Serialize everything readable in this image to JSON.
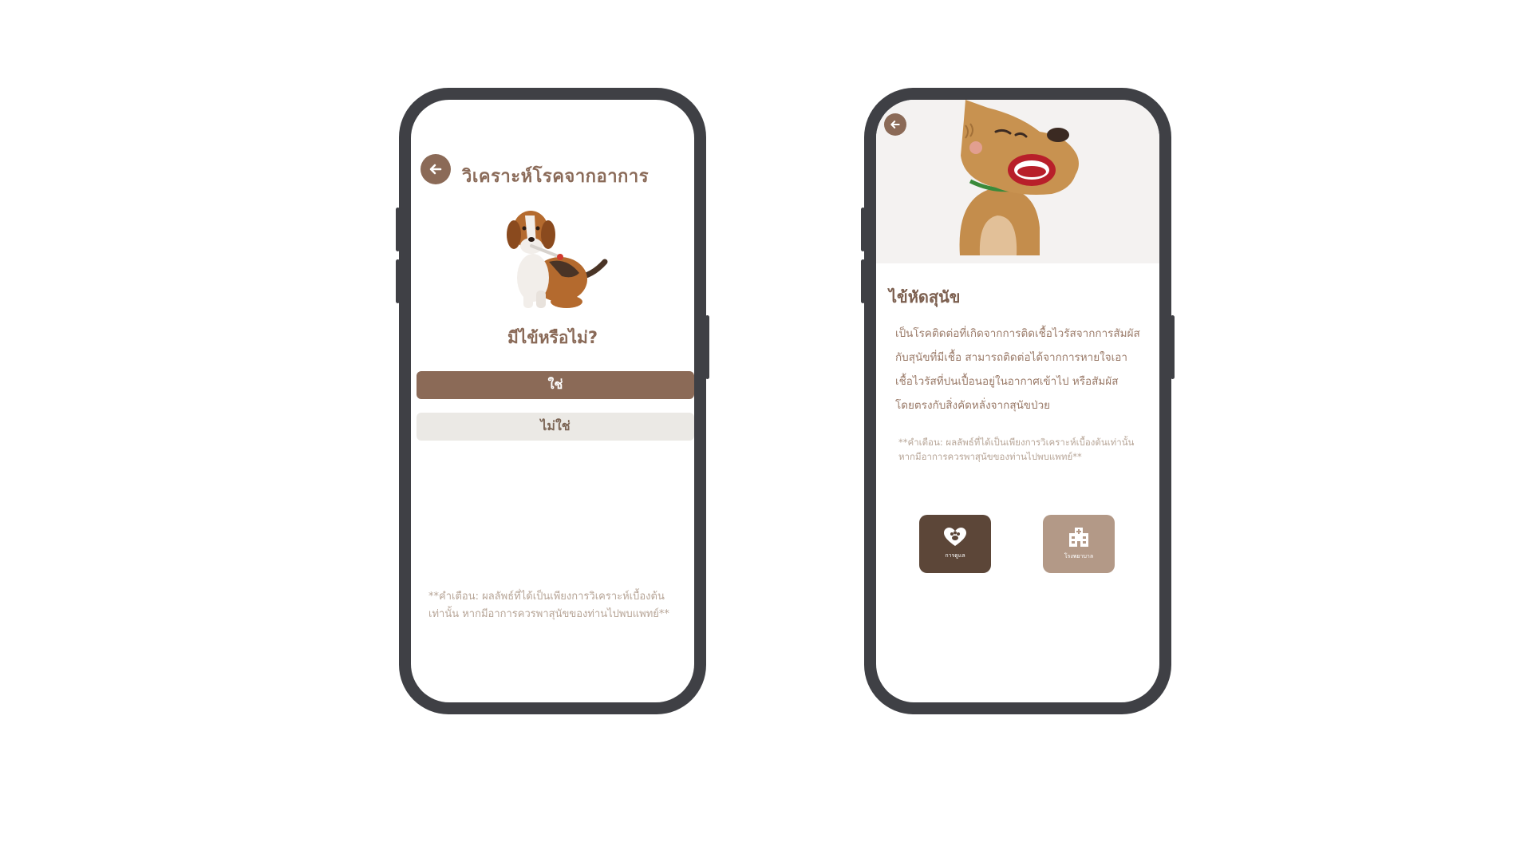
{
  "left_screen": {
    "title": "วิเคราะห์โรคจากอาการ",
    "question": "มีไข้หรือไม่?",
    "yes_label": "ใช่",
    "no_label": "ไม่ใช่",
    "warning": "**คำเตือน: ผลลัพธ์ที่ได้เป็นเพียงการวิเคราะห์เบื้องต้นเท่านั้น หากมีอาการควรพาสุนัขของท่านไปพบแพทย์**",
    "icons": [
      "back-arrow-icon",
      "beagle-thermometer-illustration"
    ]
  },
  "right_screen": {
    "title": "ไข้หัดสุนัข",
    "description": "เป็นโรคติดต่อที่เกิดจากการติดเชื้อไวรัสจากการสัมผัสกับสุนัขที่มีเชื้อ สามารถติดต่อได้จากการหายใจเอาเชื้อไวรัสที่ปนเปื้อนอยู่ในอากาศเข้าไป หรือสัมผัสโดยตรงกับสิ่งคัดหลั่งจากสุนัขป่วย",
    "warning": "**คำเตือน: ผลลัพธ์ที่ได้เป็นเพียงการวิเคราะห์เบื้องต้นเท่านั้น หากมีอาการควรพาสุนัขของท่านไปพบแพทย์**",
    "care_label": "การดูแล",
    "hospital_label": "โรงพยาบาล",
    "icons": [
      "back-arrow-icon",
      "sick-dog-illustration",
      "heart-paw-icon",
      "hospital-icon"
    ]
  },
  "colors": {
    "brown": "#8b6a57",
    "dark_brown": "#5c4638",
    "light_brown": "#b39987",
    "light_gray": "#ebe9e5",
    "phone_frame": "#3f4045"
  }
}
